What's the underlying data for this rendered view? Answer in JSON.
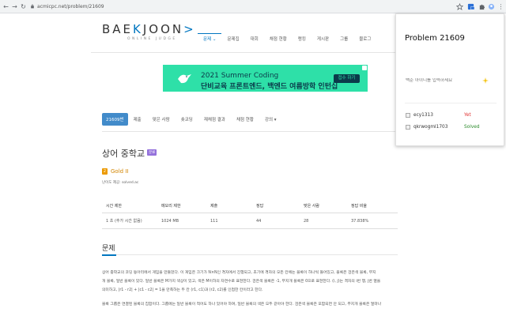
{
  "browser": {
    "url": "acmicpc.net/problem/21609"
  },
  "logo": {
    "main_prefix": "BAE",
    "main_accent": "K",
    "main_suffix": "JOON",
    "main_end": ">",
    "sub": "ONLINE JUDGE"
  },
  "nav": {
    "items": [
      {
        "label": "문제 ⌄",
        "active": true
      },
      {
        "label": "문제집"
      },
      {
        "label": "대회"
      },
      {
        "label": "채점 현황"
      },
      {
        "label": "랭킹"
      },
      {
        "label": "게시판"
      },
      {
        "label": "그룹"
      },
      {
        "label": "블로그"
      }
    ]
  },
  "ad": {
    "title": "2021 Summer Coding",
    "subtitle": "단비교육 프론트엔드, 백엔드 여름방학 인턴십",
    "button": "접수 하기"
  },
  "problem_tabs": {
    "items": [
      {
        "label": "21609번",
        "active": true
      },
      {
        "label": "제출"
      },
      {
        "label": "맞은 사람"
      },
      {
        "label": "숏코딩"
      },
      {
        "label": "재채점 결과"
      },
      {
        "label": "채점 현황"
      },
      {
        "label": "강의 ▾"
      }
    ]
  },
  "problem": {
    "title": "상어 중학교",
    "badge": "분류",
    "tier_icon": "2",
    "tier": "Gold II",
    "tier_note": "난이도 제공: solved.ac"
  },
  "table": {
    "headers": [
      "시간 제한",
      "메모리 제한",
      "제출",
      "정답",
      "맞은 사람",
      "정답 비율"
    ],
    "rows": [
      [
        "1 초 (추가 시간 없음)",
        "1024 MB",
        "111",
        "44",
        "28",
        "37.838%"
      ]
    ]
  },
  "description": {
    "heading": "문제",
    "lines": [
      "상어 중학교의 코딩 동아리에서 게임을 만들었다. 이 게임은 크기가 N×N인 격자에서 진행되고, 초기에 격자의 모든 칸에는 블록이 하나씩 들어있고, 블록은 검은색 블록, 무지",
      "개 블록, 일반 블록이 있다. 일반 블록은 M가지 색상이 있고, 색은 M이하의 자연수로 표현한다. 검은색 블록은 -1, 무지개 블록은 0으로 표현한다. (i, j)는 격자의 i번 행, j번 열을",
      "의미하고, |r1 - r2| + |c1 - c2| = 1을 만족하는 두 칸 (r1, c1)과 (r2, c2)를 인접한 칸이라고 한다.",
      "블록 그룹은 연결된 블록의 집합이다. 그룹에는 일반 블록이 적어도 하나 있어야 하며, 일반 블록의 색은 모두 같아야 한다. 검은색 블록은 포함되면 안 되고, 무지개 블록은 얼마나"
    ]
  },
  "popup": {
    "title": "Problem 21609",
    "input_placeholder": "백준 아이디를 입력하세요",
    "users": [
      {
        "name": "ecy1313",
        "status": "Yet"
      },
      {
        "name": "qkrwogml1703",
        "status": "Solved"
      }
    ]
  },
  "colors": {
    "accent": "#0076c0",
    "ad_bg": "#2ee0a8",
    "yet": "#e03030",
    "solved": "#2a8a2a",
    "tier": "#ec9a00"
  }
}
